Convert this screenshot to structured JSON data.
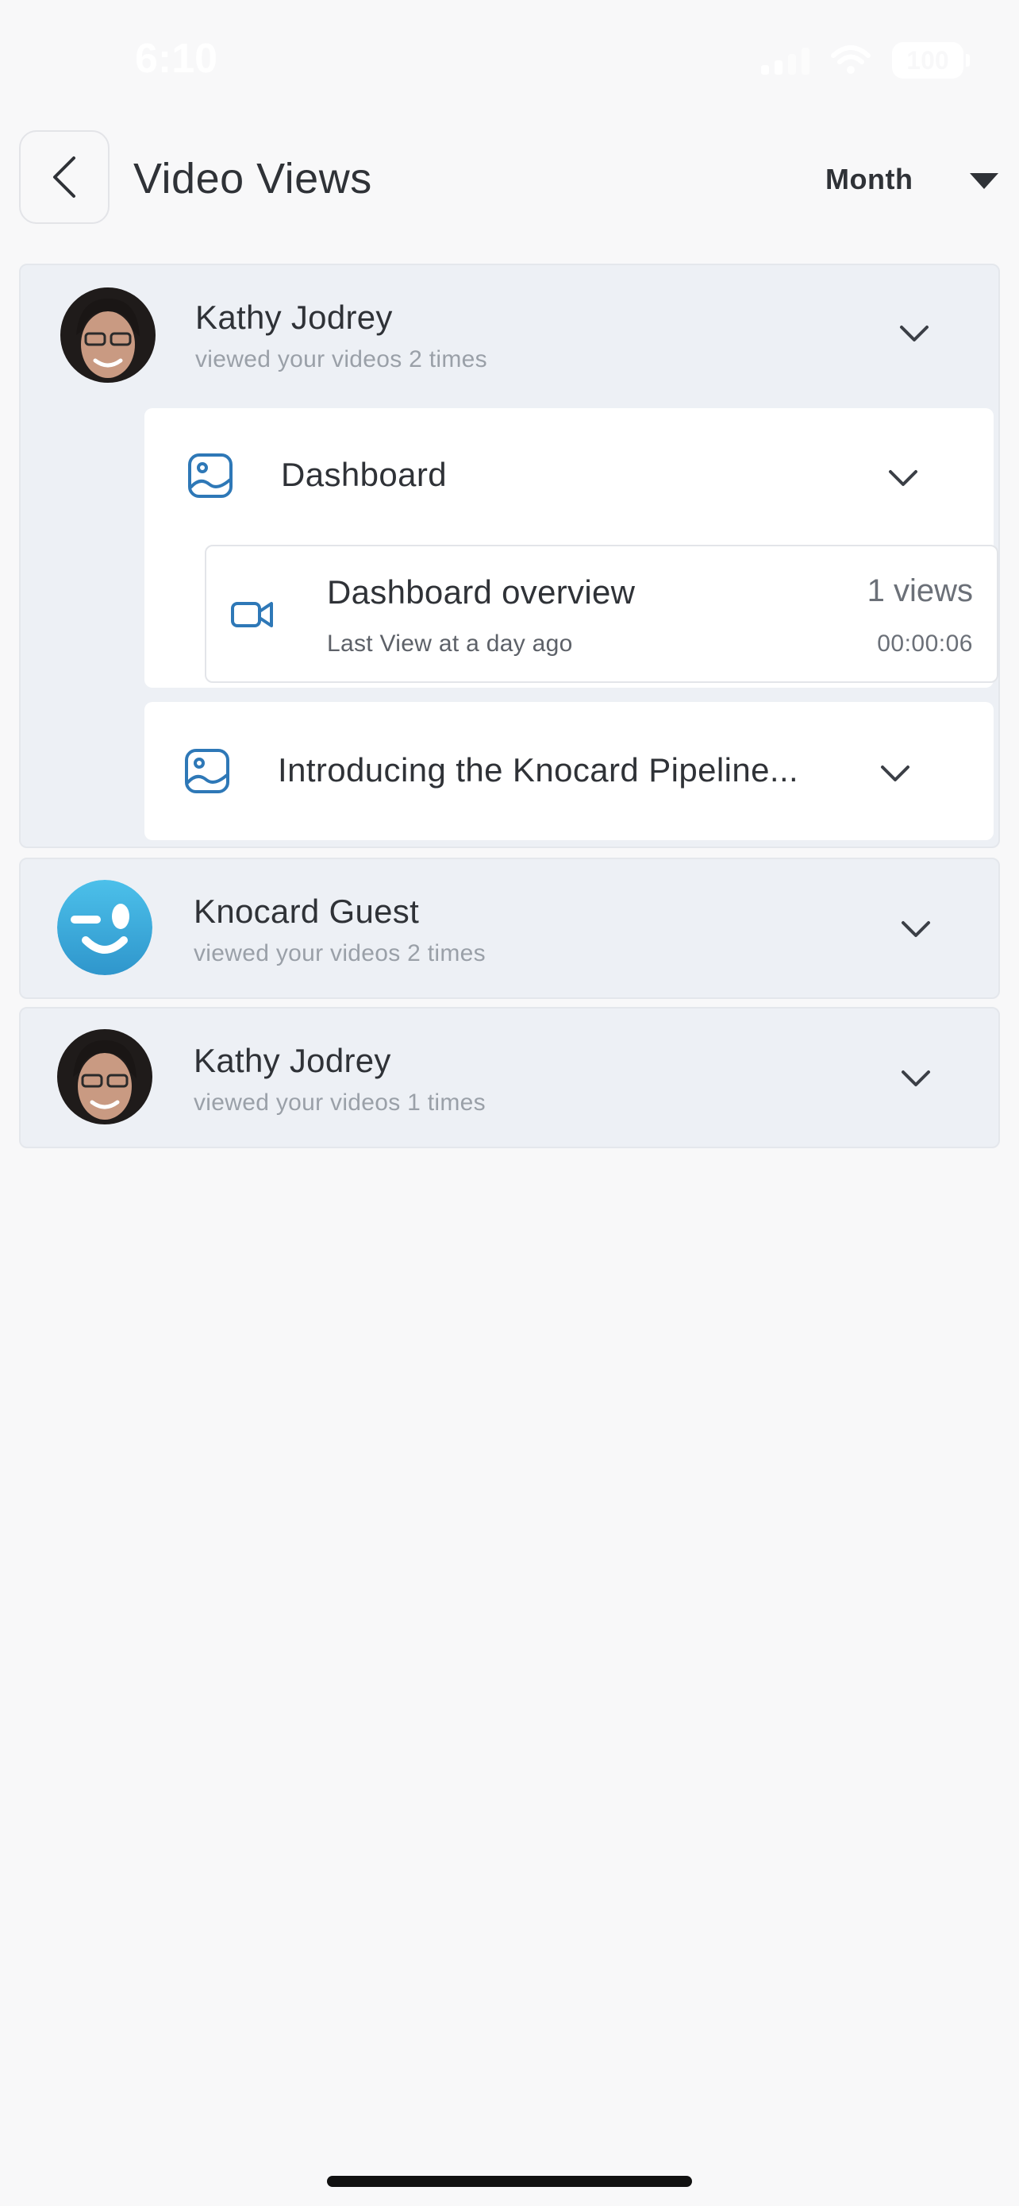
{
  "status_bar": {
    "time": "6:10",
    "battery": "100"
  },
  "header": {
    "title": "Video Views",
    "period": "Month"
  },
  "viewers": [
    {
      "name": "Kathy Jodrey",
      "subtitle": "viewed your videos 2 times",
      "expanded": true,
      "groups": [
        {
          "title": "Dashboard",
          "videos": [
            {
              "title": "Dashboard overview",
              "last_view": "Last View at a day ago",
              "views": "1 views",
              "duration": "00:00:06"
            }
          ]
        },
        {
          "title": "Introducing the Knocard Pipeline..."
        }
      ]
    },
    {
      "name": "Knocard Guest",
      "subtitle": "viewed your videos 2 times",
      "expanded": false
    },
    {
      "name": "Kathy Jodrey",
      "subtitle": "viewed your videos 1 times",
      "expanded": false
    }
  ],
  "colors": {
    "accent": "#2e78b7",
    "card_bg": "#edf0f5",
    "guest_avatar": "#3cb0e0"
  }
}
